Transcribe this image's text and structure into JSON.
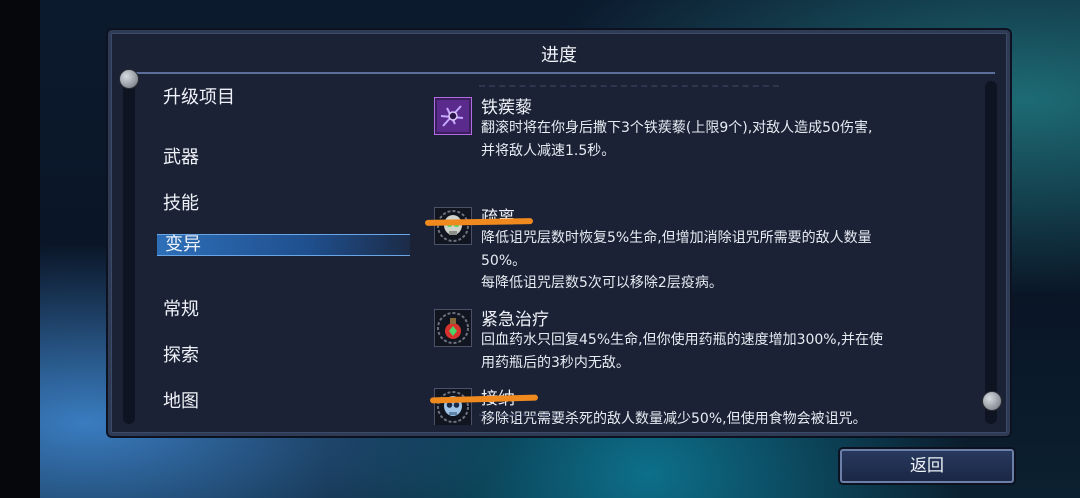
{
  "panel": {
    "title": "进度"
  },
  "menu": {
    "items": [
      "升级项目",
      "武器",
      "技能",
      "变异",
      "常规",
      "探索",
      "地图"
    ],
    "selected": "变异"
  },
  "mutations": [
    {
      "name": "铁蒺藜",
      "icon": "caltrops-icon",
      "lines": [
        "翻滚时将在你身后撒下3个铁蒺藜(上限9个),对敌人造成50伤害,",
        "并将敌人减速1.5秒。"
      ]
    },
    {
      "name": "疏离",
      "icon": "skull-icon",
      "lines": [
        "降低诅咒层数时恢复5%生命,但增加消除诅咒所需要的敌人数量",
        "50%。",
        "每降低诅咒层数5次可以移除2层疫病。"
      ]
    },
    {
      "name": "紧急治疗",
      "icon": "potion-icon",
      "lines": [
        "回血药水只回复45%生命,但你使用药瓶的速度增加300%,并在使",
        "用药瓶后的3秒内无敌。"
      ]
    },
    {
      "name": "接纳",
      "icon": "ghost-skull-icon",
      "lines": [
        "移除诅咒需要杀死的敌人数量减少50%,但使用食物会被诅咒。"
      ]
    }
  ],
  "buttons": {
    "back": "返回"
  },
  "colors": {
    "accent": "#2e6fb8",
    "highlight_marker": "#f08a1f",
    "panel": "#1b2235"
  }
}
